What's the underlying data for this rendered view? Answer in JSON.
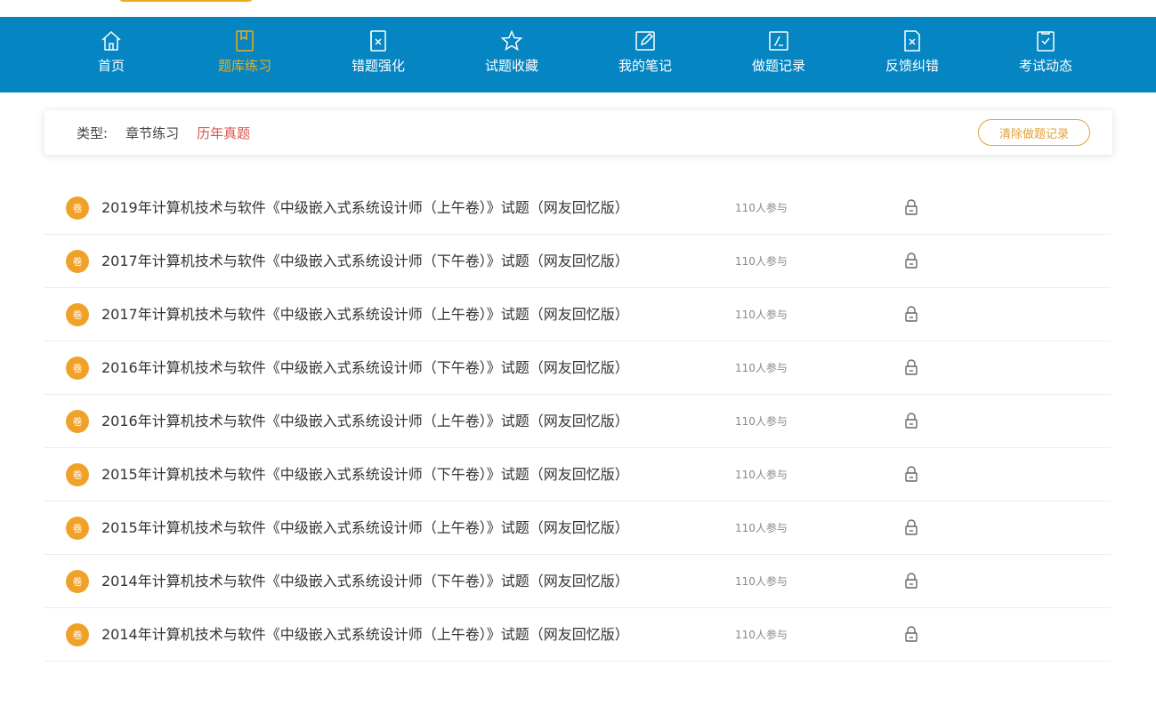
{
  "nav": {
    "items": [
      {
        "label": "首页",
        "icon": "home-icon"
      },
      {
        "label": "题库练习",
        "icon": "book-icon",
        "active": true
      },
      {
        "label": "错题强化",
        "icon": "wrong-doc-icon"
      },
      {
        "label": "试题收藏",
        "icon": "star-icon"
      },
      {
        "label": "我的笔记",
        "icon": "edit-note-icon"
      },
      {
        "label": "做题记录",
        "icon": "record-icon"
      },
      {
        "label": "反馈纠错",
        "icon": "feedback-x-icon"
      },
      {
        "label": "考试动态",
        "icon": "check-doc-icon"
      }
    ],
    "colors": {
      "bar": "#0585c2",
      "active": "#f2a91e"
    }
  },
  "filter": {
    "label": "类型:",
    "options": [
      {
        "label": "章节练习",
        "active": false
      },
      {
        "label": "历年真题",
        "active": true
      }
    ],
    "clear_button": "清除做题记录"
  },
  "papers": {
    "badge": "卷",
    "items": [
      {
        "title": "2019年计算机技术与软件《中级嵌入式系统设计师（上午卷）》试题（网友回忆版）",
        "participants": "110人参与"
      },
      {
        "title": "2017年计算机技术与软件《中级嵌入式系统设计师（下午卷）》试题（网友回忆版）",
        "participants": "110人参与"
      },
      {
        "title": "2017年计算机技术与软件《中级嵌入式系统设计师（上午卷）》试题（网友回忆版）",
        "participants": "110人参与"
      },
      {
        "title": "2016年计算机技术与软件《中级嵌入式系统设计师（下午卷）》试题（网友回忆版）",
        "participants": "110人参与"
      },
      {
        "title": "2016年计算机技术与软件《中级嵌入式系统设计师（上午卷）》试题（网友回忆版）",
        "participants": "110人参与"
      },
      {
        "title": "2015年计算机技术与软件《中级嵌入式系统设计师（下午卷）》试题（网友回忆版）",
        "participants": "110人参与"
      },
      {
        "title": "2015年计算机技术与软件《中级嵌入式系统设计师（上午卷）》试题（网友回忆版）",
        "participants": "110人参与"
      },
      {
        "title": "2014年计算机技术与软件《中级嵌入式系统设计师（下午卷）》试题（网友回忆版）",
        "participants": "110人参与"
      },
      {
        "title": "2014年计算机技术与软件《中级嵌入式系统设计师（上午卷）》试题（网友回忆版）",
        "participants": "110人参与"
      }
    ]
  }
}
